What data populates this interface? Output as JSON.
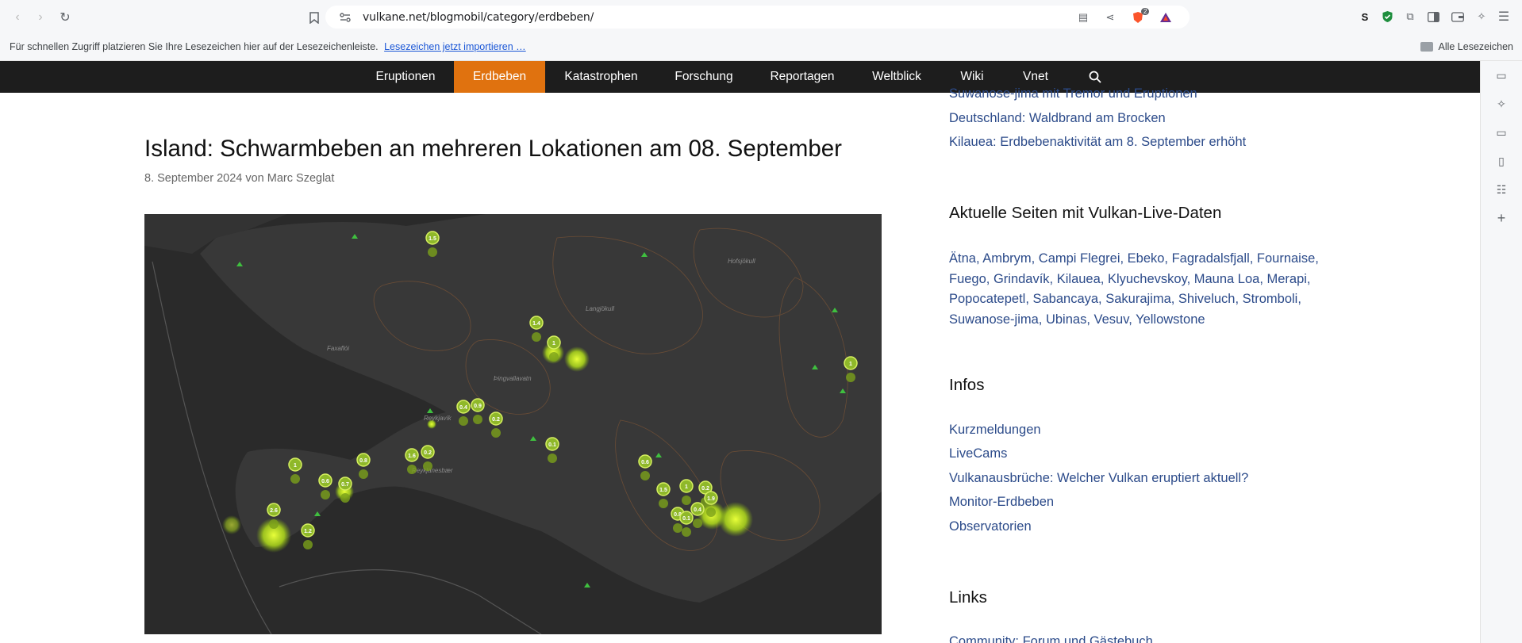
{
  "browser": {
    "url": "vulkane.net/blogmobil/category/erdbeben/",
    "brave_badge": "2",
    "extension_s_label": "S",
    "bookmarks_hint": "Für schnellen Zugriff platzieren Sie Ihre Lesezeichen hier auf der Lesezeichenleiste.",
    "bookmarks_import_link": "Lesezeichen jetzt importieren …",
    "all_bookmarks": "Alle Lesezeichen"
  },
  "nav": {
    "items": [
      {
        "label": "Eruptionen"
      },
      {
        "label": "Erdbeben"
      },
      {
        "label": "Katastrophen"
      },
      {
        "label": "Forschung"
      },
      {
        "label": "Reportagen"
      },
      {
        "label": "Weltblick"
      },
      {
        "label": "Wiki"
      },
      {
        "label": "Vnet"
      }
    ],
    "active_color": "#e0720f"
  },
  "article": {
    "title": "Island: Schwarmbeben an mehreren Lokationen am 08. September",
    "meta": "8. September 2024 von Marc Szeglat",
    "map": {
      "place_labels": [
        "Faxaflói",
        "Langjökull",
        "Þingvallavatn",
        "Reykjavík",
        "Hofsjökull",
        "Reykjanesbær"
      ],
      "markers": [
        "1.5",
        "1.4",
        "1",
        "0.4",
        "0.9",
        "0.2",
        "0.1",
        "1",
        "0.8",
        "1.6",
        "0.2",
        "0.6",
        "1.5",
        "2.6",
        "0.7",
        "1.2",
        "0.6",
        "1",
        "0.2",
        "1.9",
        "0.8",
        "0.1",
        "0.4",
        "1"
      ]
    }
  },
  "sidebar": {
    "recent_posts": [
      "Suwanose-jima mit Tremor und Eruptionen",
      "Deutschland: Waldbrand am Brocken",
      "Kilauea: Erdbebenaktivität am 8. September erhöht"
    ],
    "live_heading": "Aktuelle Seiten mit Vulkan-Live-Daten",
    "live_lines": [
      "Ätna, Ambrym, Campi Flegrei, Ebeko, Fagradalsfjall, Fournaise,",
      "Fuego, Grindavík, Kilauea, Klyuchevskoy, Mauna Loa, Merapi,",
      "Popocatepetl, Sabancaya, Sakurajima, Shiveluch, Stromboli,",
      "Suwanose-jima, Ubinas, Vesuv, Yellowstone"
    ],
    "infos_heading": "Infos",
    "infos": [
      "Kurzmeldungen",
      "LiveCams",
      "Vulkanausbrüche: Welcher Vulkan eruptiert aktuell?",
      "Monitor-Erdbeben",
      "Observatorien"
    ],
    "links_heading": "Links",
    "links": [
      "Community: Forum und Gästebuch"
    ]
  }
}
